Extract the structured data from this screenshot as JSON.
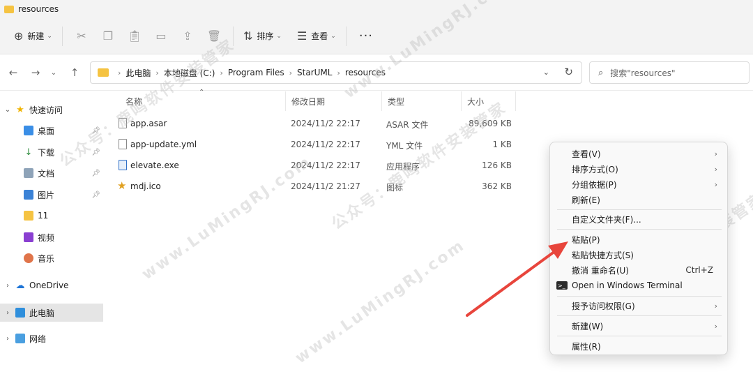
{
  "window": {
    "title": "resources"
  },
  "toolbar": {
    "new_label": "新建",
    "sort_label": "排序",
    "view_label": "查看"
  },
  "address": {
    "crumbs": [
      "此电脑",
      "本地磁盘 (C:)",
      "Program Files",
      "StarUML",
      "resources"
    ]
  },
  "search": {
    "placeholder": "搜索\"resources\""
  },
  "sidebar": {
    "items": [
      {
        "label": "快速访问",
        "icon": "star-icon"
      },
      {
        "label": "桌面",
        "icon": "desktop-icon"
      },
      {
        "label": "下载",
        "icon": "download-icon"
      },
      {
        "label": "文档",
        "icon": "document-icon"
      },
      {
        "label": "图片",
        "icon": "picture-icon"
      },
      {
        "label": "11",
        "icon": "folder-icon"
      },
      {
        "label": "视频",
        "icon": "video-icon"
      },
      {
        "label": "音乐",
        "icon": "music-icon"
      },
      {
        "label": "OneDrive",
        "icon": "cloud-icon"
      },
      {
        "label": "此电脑",
        "icon": "computer-icon"
      },
      {
        "label": "网络",
        "icon": "network-icon"
      }
    ]
  },
  "columns": {
    "name": "名称",
    "date": "修改日期",
    "type": "类型",
    "size": "大小"
  },
  "files": [
    {
      "name": "app.asar",
      "date": "2024/11/2 22:17",
      "type": "ASAR 文件",
      "size": "89,609 KB"
    },
    {
      "name": "app-update.yml",
      "date": "2024/11/2 22:17",
      "type": "YML 文件",
      "size": "1 KB"
    },
    {
      "name": "elevate.exe",
      "date": "2024/11/2 22:17",
      "type": "应用程序",
      "size": "126 KB"
    },
    {
      "name": "mdj.ico",
      "date": "2024/11/2 21:27",
      "type": "图标",
      "size": "362 KB"
    }
  ],
  "context_menu": {
    "view": "查看(V)",
    "sort": "排序方式(O)",
    "group": "分组依据(P)",
    "refresh": "刷新(E)",
    "customize": "自定义文件夹(F)...",
    "paste": "粘贴(P)",
    "paste_shortcut": "粘贴快捷方式(S)",
    "undo_rename": "撤消 重命名(U)",
    "undo_shortcut": "Ctrl+Z",
    "open_terminal": "Open in Windows Terminal",
    "grant_access": "授予访问权限(G)",
    "new": "新建(W)",
    "properties": "属性(R)"
  },
  "watermark": {
    "text1": "公众号：鹿鸣软件安装管家",
    "text2": "www.LuMingRJ.com"
  },
  "colors": {
    "arrow": "#e8453c",
    "folder": "#f5c342",
    "selected": "#e5e5e5"
  }
}
